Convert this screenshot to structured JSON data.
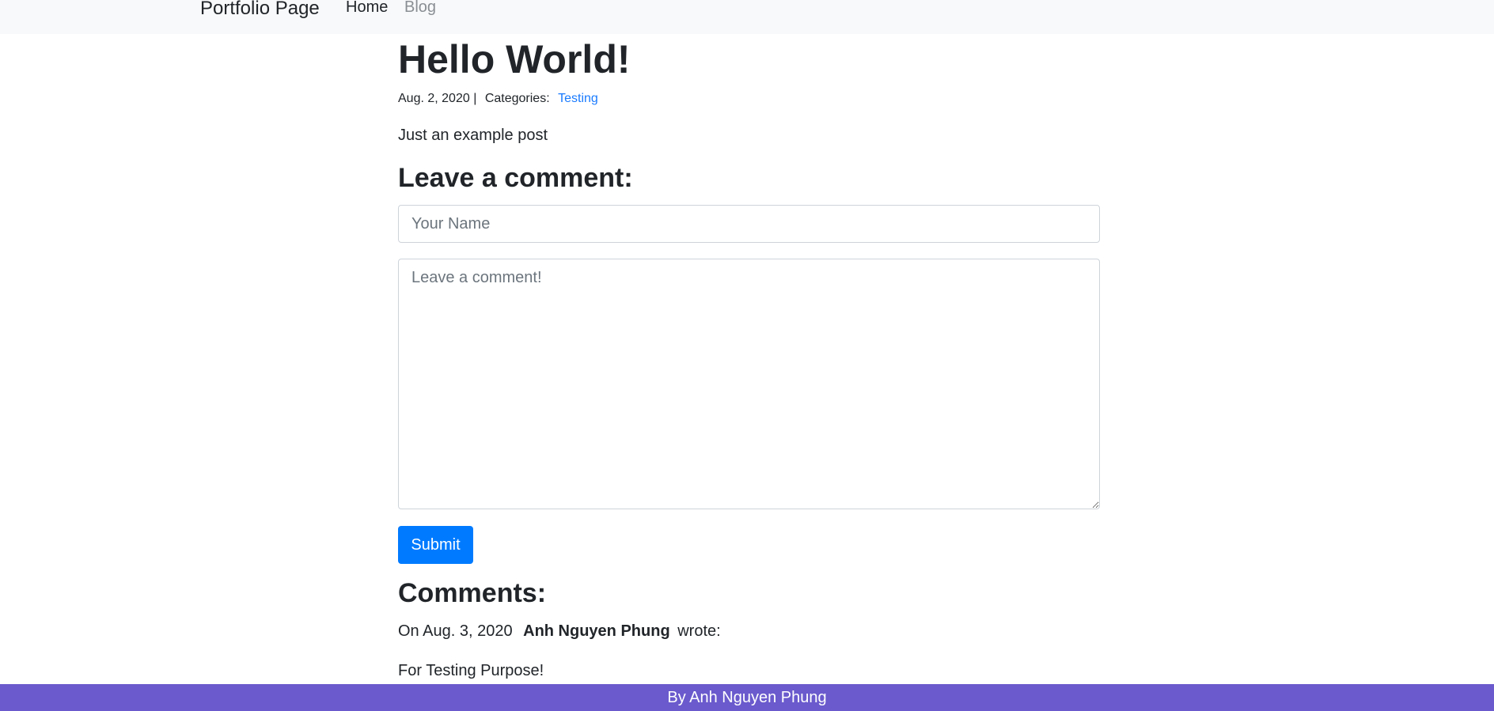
{
  "navbar": {
    "brand": "Portfolio Page",
    "links": [
      {
        "label": "Home"
      },
      {
        "label": "Blog"
      }
    ]
  },
  "post": {
    "title": "Hello World!",
    "date": "Aug. 2, 2020",
    "separator": "|",
    "categories_label": "Categories:",
    "category": "Testing",
    "body": "Just an example post"
  },
  "comment_form": {
    "title": "Leave a comment:",
    "name_placeholder": "Your Name",
    "name_value": "",
    "comment_placeholder": "Leave a comment!",
    "comment_value": "",
    "submit_label": "Submit"
  },
  "comments": {
    "title": "Comments:",
    "items": [
      {
        "prefix": "On Aug. 3, 2020",
        "author": "Anh Nguyen Phung",
        "suffix": "wrote:",
        "text": "For Testing Purpose!"
      }
    ]
  },
  "footer": {
    "text": "By Anh Nguyen Phung"
  },
  "colors": {
    "navbar_bg": "#f8f9fa",
    "link": "#1a7bff",
    "button": "#007bff",
    "footer_bg": "#6a5acd"
  }
}
